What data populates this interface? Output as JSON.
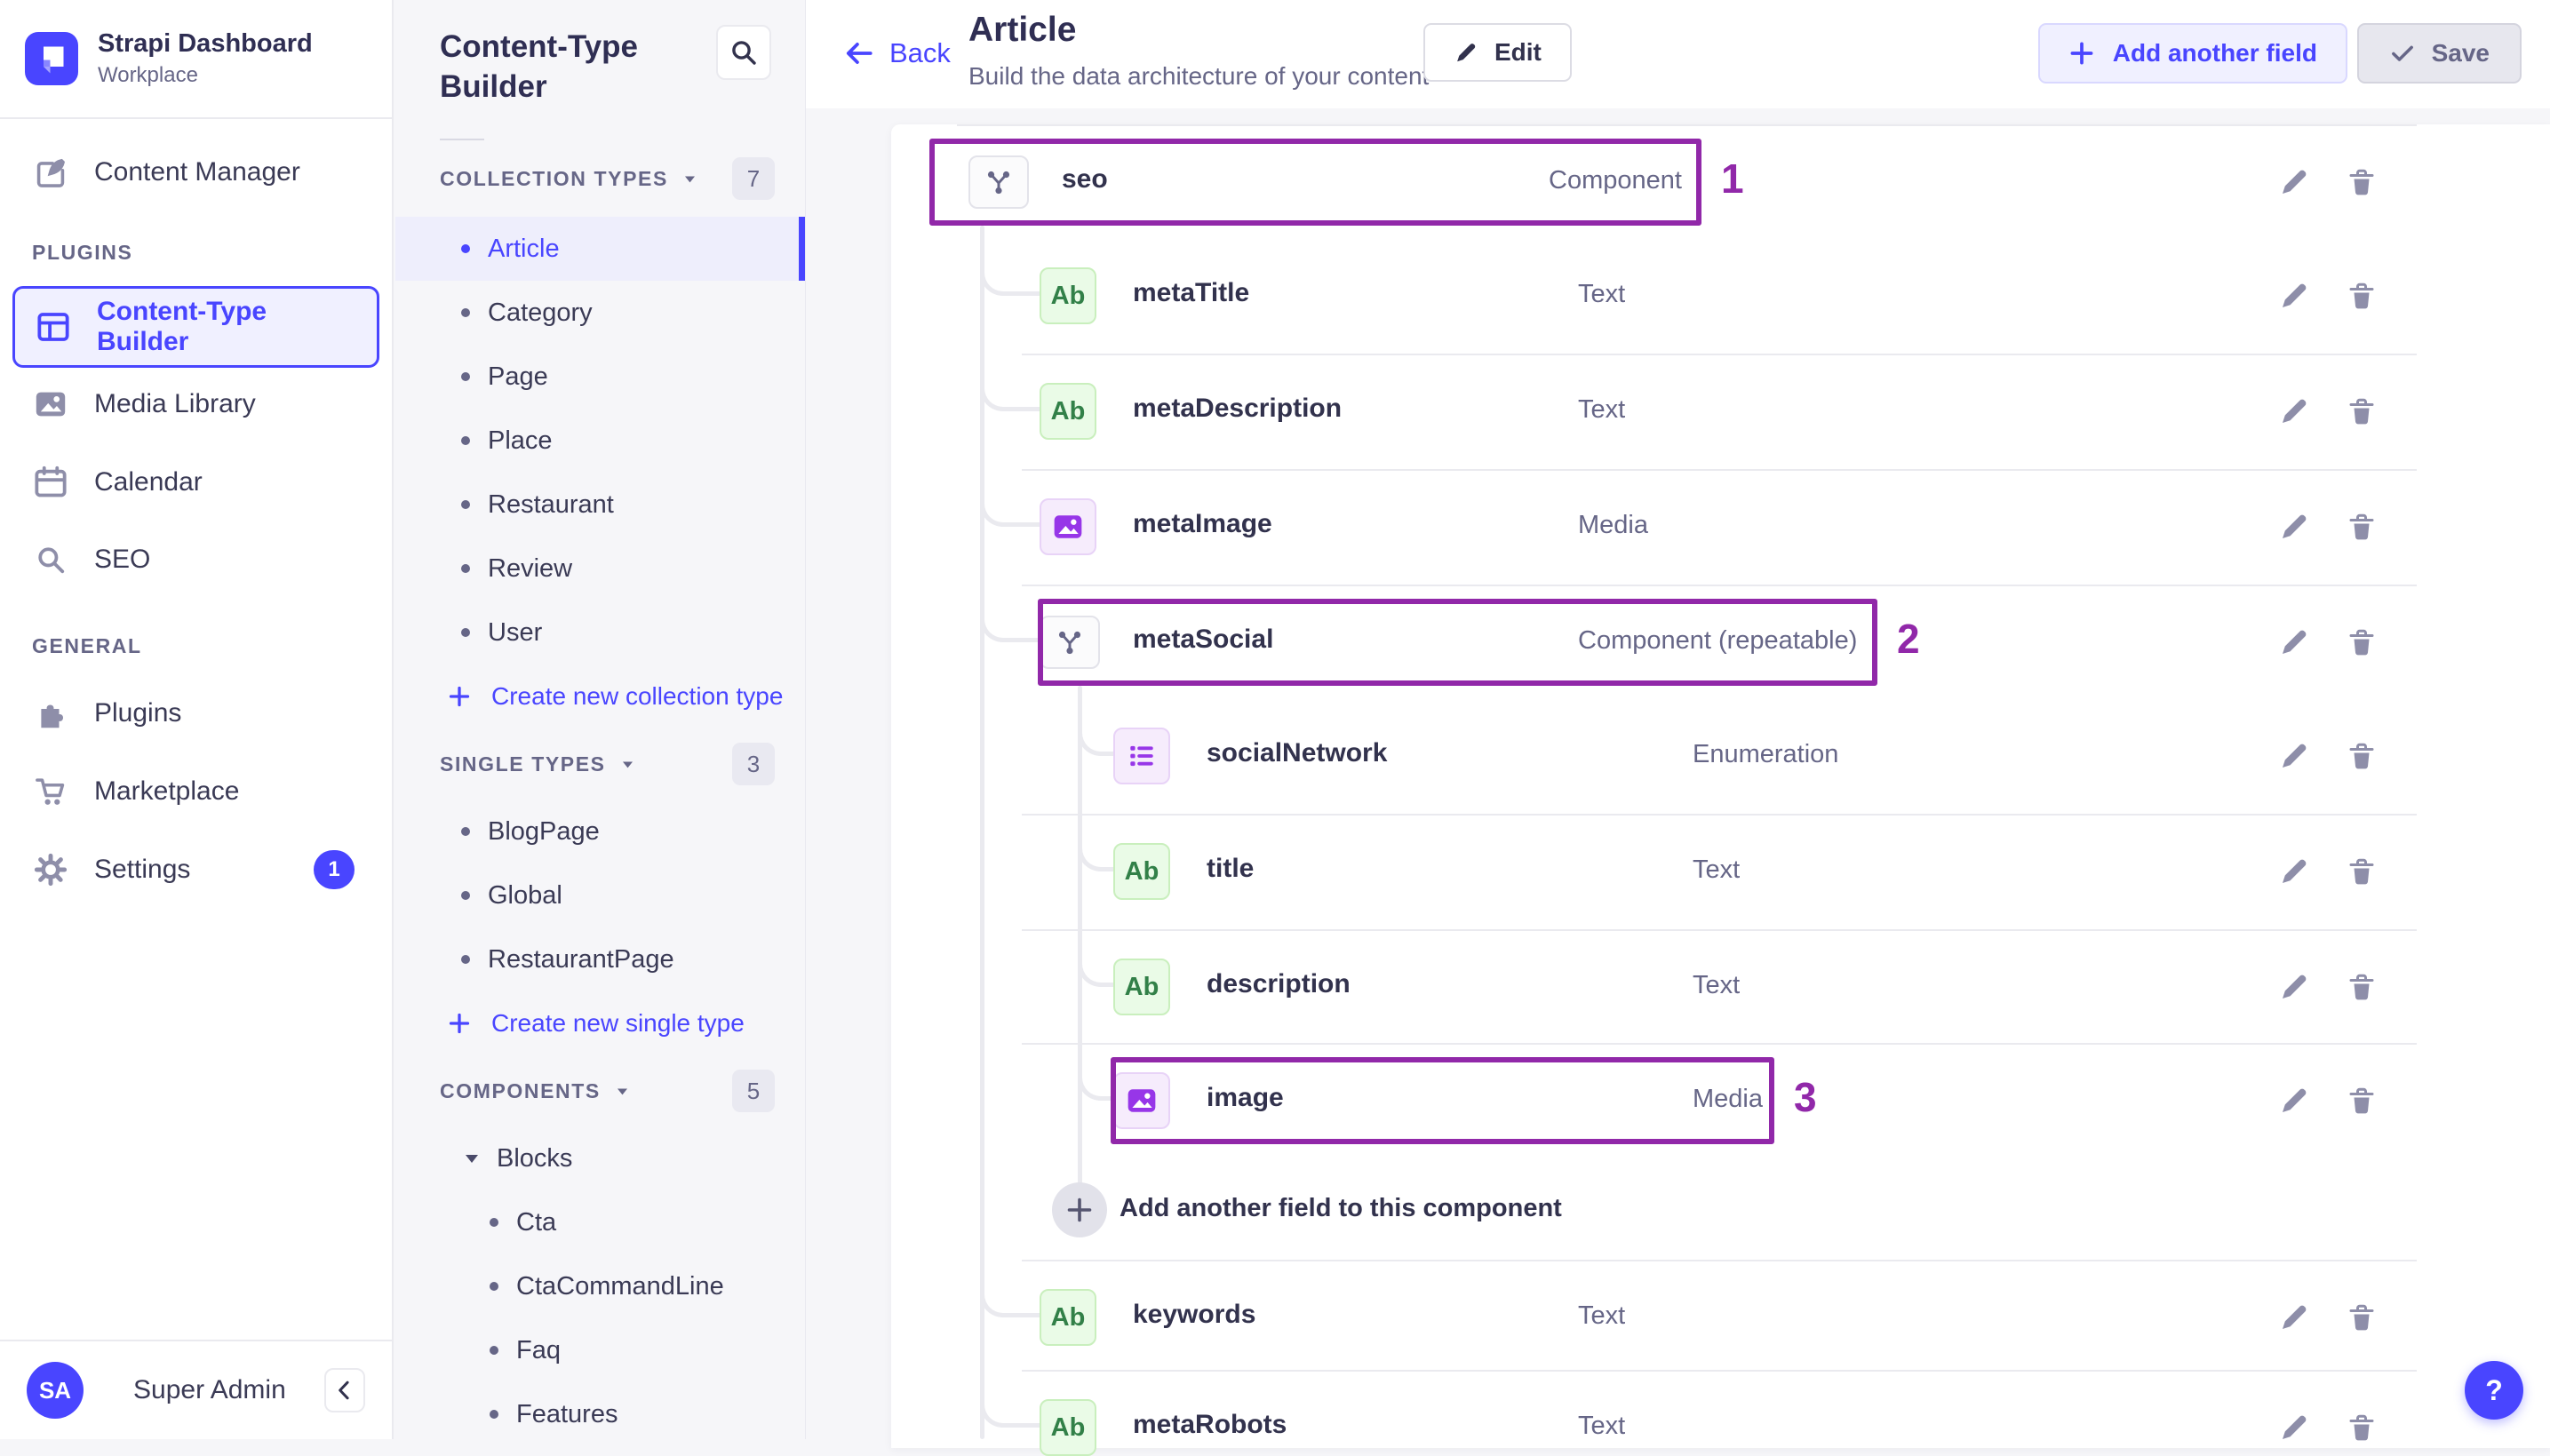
{
  "app": {
    "name": "Strapi Dashboard",
    "workspace": "Workplace",
    "user": {
      "initials": "SA",
      "name": "Super Admin"
    }
  },
  "nav": {
    "content_manager": {
      "label": "Content Manager"
    },
    "sections": [
      {
        "label": "PLUGINS",
        "items": [
          {
            "label": "Content-Type Builder",
            "icon": "layout",
            "active": true
          },
          {
            "label": "Media Library",
            "icon": "image"
          },
          {
            "label": "Calendar",
            "icon": "calendar"
          },
          {
            "label": "SEO",
            "icon": "search"
          }
        ]
      },
      {
        "label": "GENERAL",
        "items": [
          {
            "label": "Plugins",
            "icon": "puzzle"
          },
          {
            "label": "Marketplace",
            "icon": "cart"
          },
          {
            "label": "Settings",
            "icon": "gear",
            "badge": "1"
          }
        ]
      }
    ]
  },
  "builder_panel": {
    "title": "Content-Type Builder",
    "sections": [
      {
        "label": "COLLECTION TYPES",
        "count": "7",
        "items": [
          {
            "label": "Article",
            "active": true
          },
          {
            "label": "Category"
          },
          {
            "label": "Page"
          },
          {
            "label": "Place"
          },
          {
            "label": "Restaurant"
          },
          {
            "label": "Review"
          },
          {
            "label": "User"
          }
        ],
        "action": "Create new collection type"
      },
      {
        "label": "SINGLE TYPES",
        "count": "3",
        "items": [
          {
            "label": "BlogPage"
          },
          {
            "label": "Global"
          },
          {
            "label": "RestaurantPage"
          }
        ],
        "action": "Create new single type"
      },
      {
        "label": "COMPONENTS",
        "count": "5",
        "groups": [
          {
            "label": "Blocks",
            "items": [
              {
                "label": "Cta"
              },
              {
                "label": "CtaCommandLine"
              },
              {
                "label": "Faq"
              },
              {
                "label": "Features"
              }
            ]
          }
        ]
      }
    ]
  },
  "header": {
    "back": "Back",
    "title": "Article",
    "subtitle": "Build the data architecture of your content",
    "edit": "Edit",
    "add_field": "Add another field",
    "save": "Save"
  },
  "fields": [
    {
      "name": "seo",
      "type": "Component",
      "icon": "component",
      "level": 0,
      "annotation": "1",
      "divider_above": true
    },
    {
      "name": "metaTitle",
      "type": "Text",
      "icon": "text",
      "level": 1,
      "divider_above": false
    },
    {
      "name": "metaDescription",
      "type": "Text",
      "icon": "text",
      "level": 1,
      "divider_above": true
    },
    {
      "name": "metaImage",
      "type": "Media",
      "icon": "media",
      "level": 1,
      "divider_above": true
    },
    {
      "name": "metaSocial",
      "type": "Component (repeatable)",
      "icon": "component",
      "level": 1,
      "annotation": "2",
      "divider_above": true
    },
    {
      "name": "socialNetwork",
      "type": "Enumeration",
      "icon": "enum",
      "level": 2,
      "divider_above": false
    },
    {
      "name": "title",
      "type": "Text",
      "icon": "text",
      "level": 2,
      "divider_above": true
    },
    {
      "name": "description",
      "type": "Text",
      "icon": "text",
      "level": 2,
      "divider_above": true
    },
    {
      "name": "image",
      "type": "Media",
      "icon": "media",
      "level": 2,
      "annotation": "3",
      "divider_above": true
    },
    {
      "kind": "add",
      "label": "Add another field to this component",
      "level": 2,
      "divider_above": false
    },
    {
      "name": "keywords",
      "type": "Text",
      "icon": "text",
      "level": 1,
      "divider_above": true
    },
    {
      "name": "metaRobots",
      "type": "Text",
      "icon": "text",
      "level": 1,
      "divider_above": true
    }
  ],
  "help": {
    "label": "?"
  },
  "colors": {
    "accent": "#4945ff",
    "annotation": "#9128a9",
    "text_green": "#328048",
    "icon_purple": "#9736e8",
    "page_bg": "#f6f6f9"
  }
}
